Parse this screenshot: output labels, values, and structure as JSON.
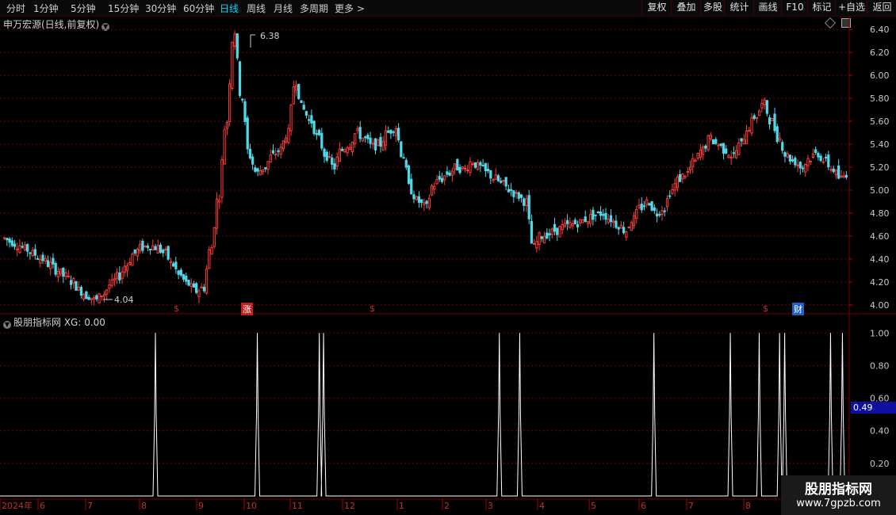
{
  "toolbar": {
    "periods": [
      "分时",
      "1分钟",
      "5分钟",
      "15分钟",
      "30分钟",
      "60分钟",
      "日线",
      "周线",
      "月线",
      "多周期",
      "更多 >"
    ],
    "active_period": "日线",
    "right_buttons": [
      "复权",
      "叠加",
      "多股",
      "统计",
      "画线",
      "F10",
      "标记",
      "+自选",
      "返回"
    ]
  },
  "main_panel": {
    "title": "申万宏源(日线,前复权)",
    "high_label": "6.38",
    "low_label": "4.04",
    "markers": [
      {
        "text": "$",
        "kind": "dollar"
      },
      {
        "text": "涨",
        "kind": "up-badge"
      },
      {
        "text": "$",
        "kind": "dollar"
      },
      {
        "text": "$",
        "kind": "dollar"
      },
      {
        "text": "财",
        "kind": "fin-badge"
      }
    ]
  },
  "indicator_panel": {
    "title": "股朋指标网 XG: 0.00",
    "current_value": "0.49"
  },
  "xaxis": {
    "labels": [
      "2024年",
      "6",
      "7",
      "8",
      "9",
      "10",
      "11",
      "12",
      "1",
      "2",
      "3",
      "4",
      "5",
      "6",
      "7",
      "8"
    ]
  },
  "watermark": {
    "name": "股朋指标网",
    "url": "www.7gpzb.com"
  },
  "colors": {
    "up": "#ff3a3a",
    "down": "#4ed8e8",
    "grid": "#7a0000",
    "indicator": "#ffffff",
    "active_tab": "#00d8ff"
  },
  "chart_data": [
    {
      "type": "candlestick",
      "title": "申万宏源(日线,前复权)",
      "ylim": [
        3.95,
        6.45
      ],
      "y_ticks": [
        4.0,
        4.2,
        4.4,
        4.6,
        4.8,
        5.0,
        5.2,
        5.4,
        5.6,
        5.8,
        6.0,
        6.2,
        6.4
      ],
      "x_months": [
        "2024年",
        "6",
        "7",
        "8",
        "9",
        "10",
        "11",
        "12",
        "1",
        "2",
        "3",
        "4",
        "5",
        "6",
        "7",
        "8"
      ],
      "close_series_approx": [
        4.58,
        4.55,
        4.52,
        4.48,
        4.44,
        4.4,
        4.35,
        4.3,
        4.25,
        4.2,
        4.12,
        4.08,
        4.04,
        4.1,
        4.18,
        4.25,
        4.35,
        4.45,
        4.5,
        4.52,
        4.5,
        4.45,
        4.35,
        4.25,
        4.18,
        4.12,
        4.15,
        4.5,
        4.95,
        5.6,
        6.38,
        5.8,
        5.3,
        5.15,
        5.2,
        5.3,
        5.35,
        5.5,
        5.95,
        5.7,
        5.6,
        5.45,
        5.3,
        5.2,
        5.35,
        5.4,
        5.5,
        5.45,
        5.38,
        5.4,
        5.5,
        5.55,
        5.3,
        5.0,
        4.9,
        4.85,
        5.05,
        5.1,
        5.15,
        5.2,
        5.18,
        5.25,
        5.2,
        5.15,
        5.1,
        5.05,
        5.0,
        4.95,
        4.9,
        4.5,
        4.6,
        4.62,
        4.65,
        4.68,
        4.7,
        4.72,
        4.75,
        4.78,
        4.8,
        4.75,
        4.7,
        4.65,
        4.75,
        4.85,
        4.9,
        4.8,
        4.85,
        5.0,
        5.1,
        5.15,
        5.25,
        5.35,
        5.45,
        5.4,
        5.35,
        5.3,
        5.4,
        5.55,
        5.65,
        5.75,
        5.6,
        5.45,
        5.3,
        5.25,
        5.2,
        5.28,
        5.32,
        5.25,
        5.18,
        5.1,
        5.15
      ],
      "high_label": 6.38,
      "low_label": 4.04
    },
    {
      "type": "line",
      "title": "股朋指标网 XG: 0.00",
      "ylim": [
        0,
        1.05
      ],
      "y_ticks": [
        0.2,
        0.4,
        0.6,
        0.8,
        1.0
      ],
      "current_value": 0.49,
      "signal_positions_frac": [
        0.183,
        0.303,
        0.376,
        0.381,
        0.588,
        0.612,
        0.77,
        0.86,
        0.894,
        0.918,
        0.924,
        0.978,
        0.992
      ],
      "signal_peak": 1.0
    }
  ]
}
